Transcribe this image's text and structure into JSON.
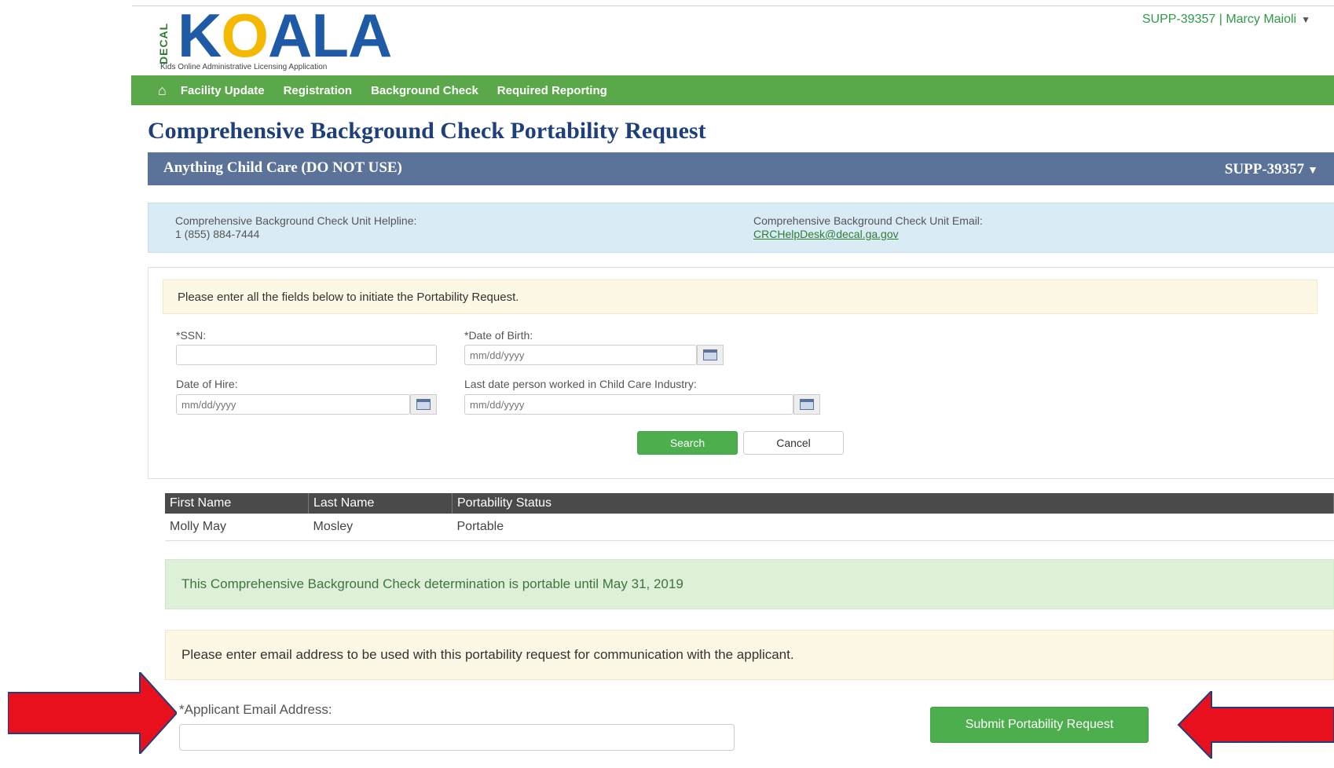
{
  "brand": {
    "decal": "DECAL",
    "logo_k": "K",
    "logo_o": "O",
    "logo_rest": "ALA",
    "tagline": "Kids Online Administrative Licensing Application"
  },
  "user_menu": {
    "label": "SUPP-39357 | Marcy Maioli"
  },
  "nav": {
    "items": [
      {
        "label": "Facility Update"
      },
      {
        "label": "Registration"
      },
      {
        "label": "Background Check"
      },
      {
        "label": "Required Reporting"
      }
    ]
  },
  "page": {
    "title": "Comprehensive Background Check Portability Request"
  },
  "facility": {
    "name": "Anything Child Care (DO NOT USE)",
    "id": "SUPP-39357"
  },
  "contact": {
    "helpline_label": "Comprehensive Background Check Unit Helpline:",
    "helpline_number": "1 (855) 884-7444",
    "email_label": "Comprehensive Background Check Unit Email:",
    "email": "CRCHelpDesk@decal.ga.gov"
  },
  "form": {
    "instruction": "Please enter all the fields below to initiate the Portability Request.",
    "ssn_label": "*SSN:",
    "ssn_value": "",
    "dob_label": "*Date of Birth:",
    "dob_placeholder": "mm/dd/yyyy",
    "hire_label": "Date of Hire:",
    "hire_placeholder": "mm/dd/yyyy",
    "last_worked_label": "Last date person worked in Child Care Industry:",
    "last_worked_placeholder": "mm/dd/yyyy",
    "search_label": "Search",
    "cancel_label": "Cancel"
  },
  "results": {
    "columns": [
      "First Name",
      "Last Name",
      "Portability Status"
    ],
    "rows": [
      {
        "first": "Molly May",
        "last": "Mosley",
        "status": "Portable"
      }
    ]
  },
  "portability_message": "This Comprehensive Background Check determination is portable until May 31, 2019",
  "email_instruction": "Please enter email address to be used with this portability request for communication with the applicant.",
  "applicant_email": {
    "label": "*Applicant Email Address:",
    "value": ""
  },
  "submit": {
    "label": "Submit Portability Request"
  },
  "colors": {
    "nav_green": "#5aa84a",
    "title_blue": "#1f3f7a",
    "facility_bar": "#5b7399",
    "button_green": "#4cae4c",
    "annotation_red": "#e8101c"
  }
}
